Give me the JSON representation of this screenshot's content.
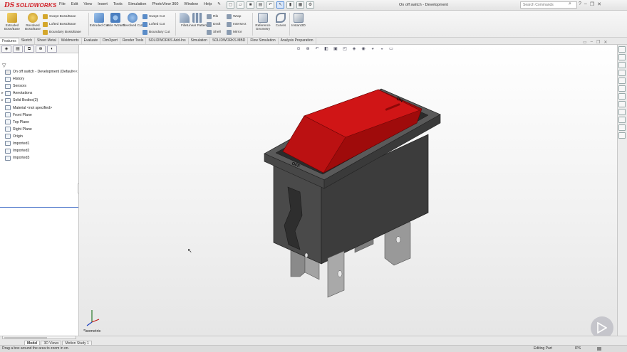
{
  "app": {
    "logo_ds": "DS",
    "logo_text": "SOLIDWORKS",
    "document_title": "On off switch - Development",
    "search_placeholder": "Search Commands",
    "menu": [
      "File",
      "Edit",
      "View",
      "Insert",
      "Tools",
      "Simulation",
      "PhotoView 360",
      "Window",
      "Help"
    ]
  },
  "command_manager": {
    "extruded_boss": "Extruded Boss/Base",
    "revolved_boss": "Revolved Boss/Base",
    "swept_boss": "Swept Boss/Base",
    "lofted_boss": "Lofted Boss/Base",
    "boundary_boss": "Boundary Boss/Base",
    "extruded_cut": "Extruded Cut",
    "hole_wizard": "Hole Wizard",
    "revolved_cut": "Revolved Cut",
    "swept_cut": "Swept Cut",
    "lofted_cut": "Lofted Cut",
    "boundary_cut": "Boundary Cut",
    "fillet": "Fillet",
    "linear_pattern": "Linear Pattern",
    "rib": "Rib",
    "draft": "Draft",
    "shell": "Shell",
    "wrap": "Wrap",
    "intersect": "Intersect",
    "mirror": "Mirror",
    "reference_geometry": "Reference Geometry",
    "curves": "Curves",
    "instant3d": "Instant3D"
  },
  "tabs": [
    "Features",
    "Sketch",
    "Sheet Metal",
    "Weldments",
    "Evaluate",
    "DimXpert",
    "Render Tools",
    "SOLIDWORKS Add-Ins",
    "Simulation",
    "SOLIDWORKS MBD",
    "Flow Simulation",
    "Analysis Preparation"
  ],
  "feature_tree": {
    "root": "On off switch - Development  (Default<<",
    "items": [
      {
        "label": "History",
        "expand": ""
      },
      {
        "label": "Sensors",
        "expand": ""
      },
      {
        "label": "Annotations",
        "expand": "▸"
      },
      {
        "label": "Solid Bodies(3)",
        "expand": "▸"
      },
      {
        "label": "Material <not specified>",
        "expand": ""
      },
      {
        "label": "Front Plane",
        "expand": ""
      },
      {
        "label": "Top Plane",
        "expand": ""
      },
      {
        "label": "Right Plane",
        "expand": ""
      },
      {
        "label": "Origin",
        "expand": ""
      },
      {
        "label": "Imported1",
        "expand": ""
      },
      {
        "label": "Imported2",
        "expand": ""
      },
      {
        "label": "Imported3",
        "expand": ""
      }
    ]
  },
  "graphics": {
    "view_name": "*Isometric",
    "model_label_on": "ON",
    "model_label_off": "OFF",
    "colors": {
      "rocker": "#c80f10",
      "housing": "#3c3c3c",
      "terminal": "#8c8c8c"
    }
  },
  "bottom_tabs": [
    "Model",
    "3D Views",
    "Motion Study 1"
  ],
  "status": {
    "message": "Drag a box around the area to zoom in on.",
    "mode": "Editing Part",
    "units": "IPS"
  }
}
